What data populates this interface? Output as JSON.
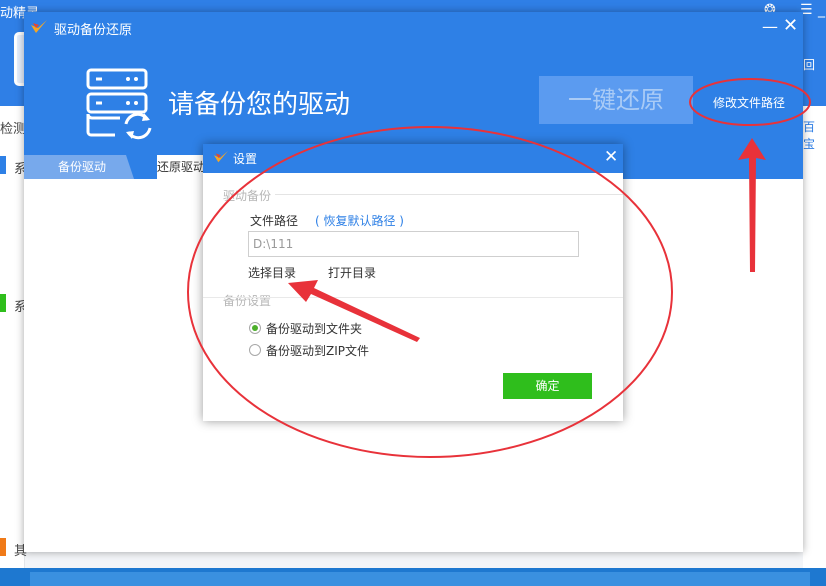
{
  "background_app": {
    "title_fragment": "动精灵",
    "side_items": [
      "检测",
      "系",
      "系",
      "其"
    ],
    "right_items": [
      "回",
      "百宝"
    ]
  },
  "window": {
    "title": "驱动备份还原",
    "minimize": "—",
    "close": "✕",
    "hero_text": "请备份您的驱动",
    "restore_button": "一键还原",
    "modify_path_link": "修改文件路径",
    "tabs": [
      {
        "label": "备份驱动",
        "active": true
      },
      {
        "label": "还原驱动",
        "active": false
      }
    ]
  },
  "settings_dialog": {
    "title": "设置",
    "close": "✕",
    "driver_backup_section": "驱动备份",
    "file_path_label": "文件路径",
    "restore_default_link": "( 恢复默认路径 )",
    "path_value": "D:\\111",
    "choose_dir": "选择目录",
    "open_dir": "打开目录",
    "backup_settings_section": "备份设置",
    "options": [
      {
        "label": "备份驱动到文件夹",
        "selected": true
      },
      {
        "label": "备份驱动到ZIP文件",
        "selected": false
      }
    ],
    "ok_button": "确定"
  },
  "colors": {
    "brand_blue": "#2e80e6",
    "ok_green": "#2fbe1c",
    "annotation_red": "#e8323a"
  }
}
